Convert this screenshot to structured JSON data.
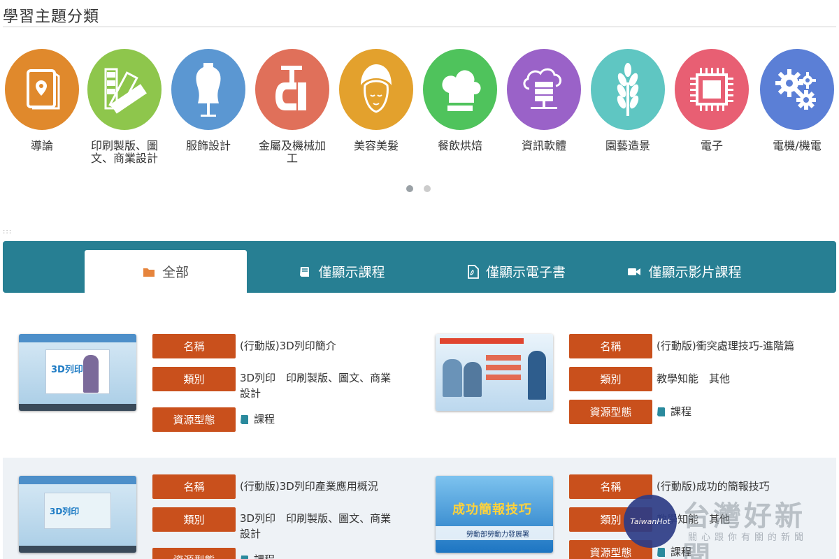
{
  "section_title": "學習主題分類",
  "topics": [
    {
      "label": "導論",
      "color": "#e0892c",
      "icon": "map-pin-icon"
    },
    {
      "label": "印刷製版、圖文、商業設計",
      "color": "#8ec64c",
      "icon": "color-swatch-icon"
    },
    {
      "label": "服飾設計",
      "color": "#5b97d2",
      "icon": "dress-form-icon"
    },
    {
      "label": "金屬及機械加工",
      "color": "#e0705a",
      "icon": "c-clamp-icon"
    },
    {
      "label": "美容美髮",
      "color": "#e3a12d",
      "icon": "hair-towel-icon"
    },
    {
      "label": "餐飲烘焙",
      "color": "#4fc35c",
      "icon": "chef-hat-icon"
    },
    {
      "label": "資訊軟體",
      "color": "#9a62c8",
      "icon": "cloud-server-icon"
    },
    {
      "label": "園藝造景",
      "color": "#5fc6c2",
      "icon": "wheat-icon"
    },
    {
      "label": "電子",
      "color": "#e85f73",
      "icon": "chip-icon"
    },
    {
      "label": "電機/機電",
      "color": "#5b7fd6",
      "icon": "gears-icon"
    }
  ],
  "marker": ":::",
  "tabs": [
    {
      "label": "全部",
      "icon": "folder-icon",
      "active": true
    },
    {
      "label": "僅顯示課程",
      "icon": "book-icon",
      "active": false
    },
    {
      "label": "僅顯示電子書",
      "icon": "pdf-file-icon",
      "active": false
    },
    {
      "label": "僅顯示影片課程",
      "icon": "video-camera-icon",
      "active": false
    }
  ],
  "field_labels": {
    "name": "名稱",
    "category": "類別",
    "type": "資源型態"
  },
  "resources": [
    {
      "name": "(行動版)3D列印簡介",
      "category": "3D列印　印刷製版、圖文、商業設計",
      "type": "課程"
    },
    {
      "name": "(行動版)衝突處理技巧-進階篇",
      "category": "教學知能　其他",
      "type": "課程"
    },
    {
      "name": "(行動版)3D列印產業應用概況",
      "category": "3D列印　印刷製版、圖文、商業設計",
      "type": "課程"
    },
    {
      "name": "(行動版)成功的簡報技巧",
      "category": "教學知能　其他",
      "type": "課程"
    }
  ],
  "thumb_text": {
    "t1": "3D列印",
    "t3": "3D列印",
    "t4_title": "成功簡報技巧",
    "t4_org": "勞動部勞動力發展署"
  },
  "watermark": {
    "ball": "TaiwanHot",
    "main": "台灣好新聞",
    "sub": "關心跟你有關的新聞"
  }
}
